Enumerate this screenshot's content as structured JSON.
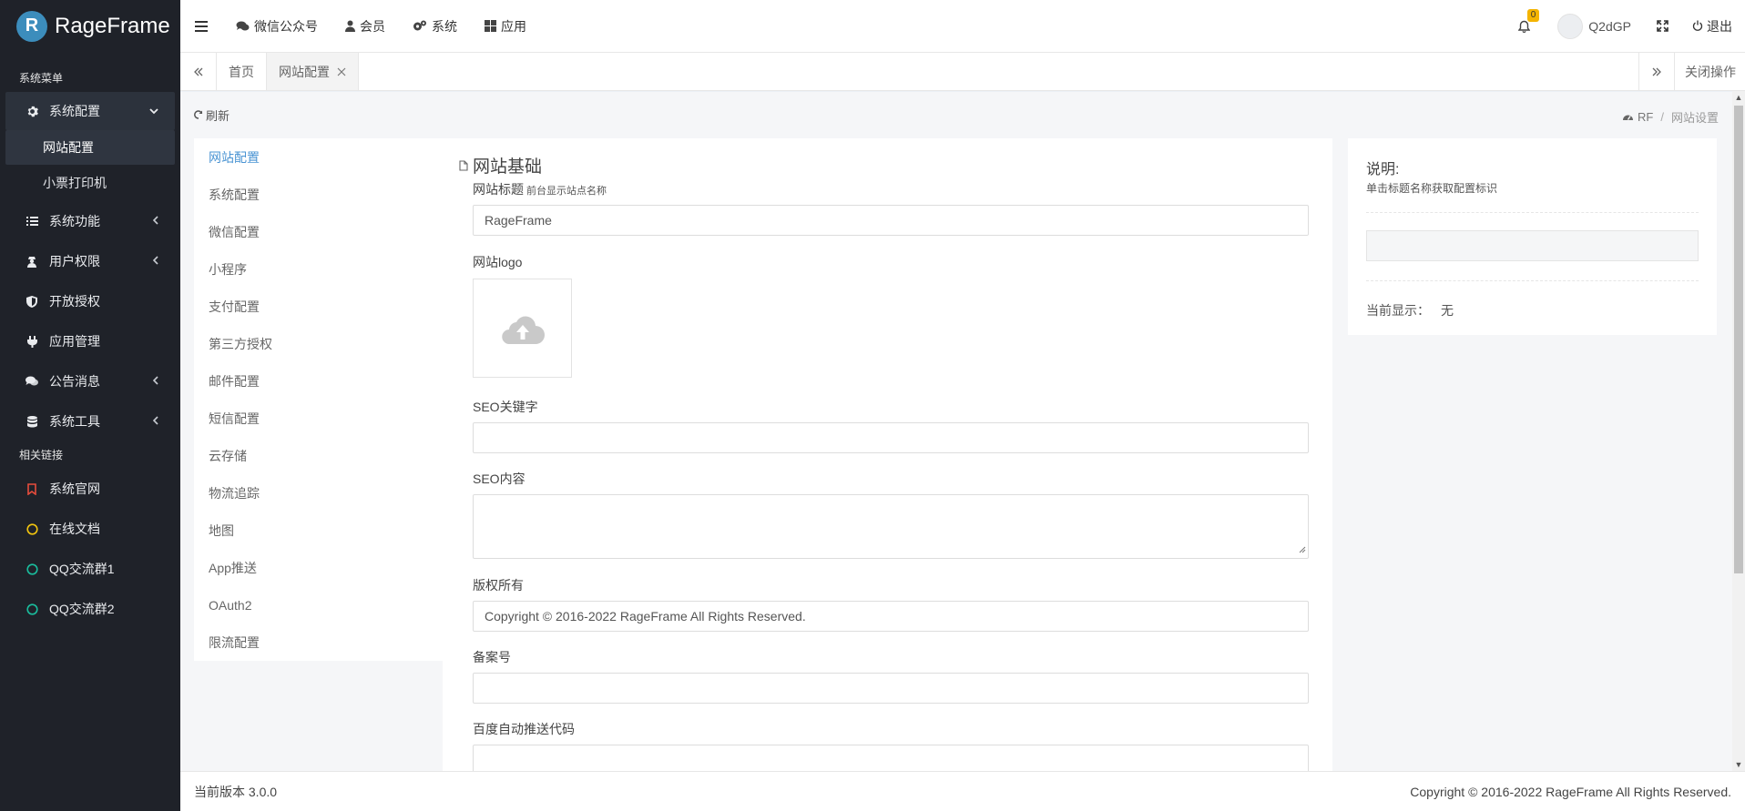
{
  "brand": {
    "name": "RageFrame",
    "badge": "R"
  },
  "sidebar": {
    "section_main": "系统菜单",
    "items": [
      {
        "label": "系统配置",
        "icon": "gear-icon",
        "expanded": true
      },
      {
        "label": "系统功能",
        "icon": "list-icon"
      },
      {
        "label": "用户权限",
        "icon": "user-secret-icon"
      },
      {
        "label": "开放授权",
        "icon": "shield-icon"
      },
      {
        "label": "应用管理",
        "icon": "plug-icon"
      },
      {
        "label": "公告消息",
        "icon": "comments-icon"
      },
      {
        "label": "系统工具",
        "icon": "database-icon"
      }
    ],
    "sub_items": [
      {
        "label": "网站配置",
        "current": true
      },
      {
        "label": "小票打印机"
      }
    ],
    "section_links": "相关链接",
    "links": [
      {
        "label": "系统官网",
        "icon": "bookmark-icon",
        "color": "#e74c3c"
      },
      {
        "label": "在线文档",
        "icon": "circle-icon",
        "color": "#f1c40f"
      },
      {
        "label": "QQ交流群1",
        "icon": "circle-icon",
        "color": "#1abc9c"
      },
      {
        "label": "QQ交流群2",
        "icon": "circle-icon",
        "color": "#1abc9c"
      }
    ]
  },
  "topbar": {
    "nav": [
      {
        "label": "微信公众号",
        "icon": "comments-icon"
      },
      {
        "label": "会员",
        "icon": "user-icon"
      },
      {
        "label": "系统",
        "icon": "cogs-icon"
      },
      {
        "label": "应用",
        "icon": "grid-icon"
      }
    ],
    "notification_count": "0",
    "username": "Q2dGP",
    "logout": "退出"
  },
  "tabs": {
    "items": [
      {
        "label": "首页"
      },
      {
        "label": "网站配置",
        "active": true
      }
    ],
    "close_ops": "关闭操作"
  },
  "content": {
    "refresh": "刷新",
    "breadcrumb": [
      "RF",
      "网站设置"
    ],
    "config_nav": [
      "网站配置",
      "系统配置",
      "微信配置",
      "小程序",
      "支付配置",
      "第三方授权",
      "邮件配置",
      "短信配置",
      "云存储",
      "物流追踪",
      "地图",
      "App推送",
      "OAuth2",
      "限流配置"
    ],
    "form": {
      "title": "网站基础",
      "site_title_label": "网站标题",
      "site_title_hint": "前台显示站点名称",
      "site_title_value": "RageFrame",
      "logo_label": "网站logo",
      "seo_keywords_label": "SEO关键字",
      "seo_keywords_value": "",
      "seo_content_label": "SEO内容",
      "copyright_label": "版权所有",
      "copyright_value": "Copyright © 2016-2022 RageFrame All Rights Reserved.",
      "icp_label": "备案号",
      "icp_value": "",
      "baidu_label": "百度自动推送代码"
    },
    "help": {
      "title": "说明:",
      "desc": "单击标题名称获取配置标识",
      "current_label": "当前显示：",
      "current_value": "无"
    }
  },
  "footer": {
    "version": "当前版本 3.0.0",
    "copyright": "Copyright © 2016-2022 RageFrame All Rights Reserved."
  }
}
